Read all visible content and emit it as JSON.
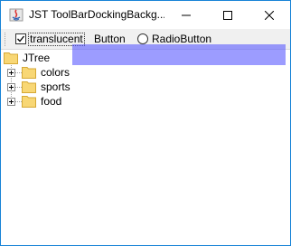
{
  "window": {
    "title": "JST ToolBarDockingBackg...",
    "minimize_icon": "minimize-icon",
    "maximize_icon": "maximize-icon",
    "close_icon": "close-icon"
  },
  "toolbar": {
    "checkbox_label": "translucent",
    "checkbox_checked": true,
    "button_label": "Button",
    "radio_label": "RadioButton",
    "radio_selected": false,
    "overlay_color": "#5a5aff"
  },
  "tree": {
    "root_label": "JTree",
    "children": [
      {
        "label": "colors",
        "expanded": false
      },
      {
        "label": "sports",
        "expanded": false
      },
      {
        "label": "food",
        "expanded": false
      }
    ],
    "folder_color": "#f8d775"
  }
}
